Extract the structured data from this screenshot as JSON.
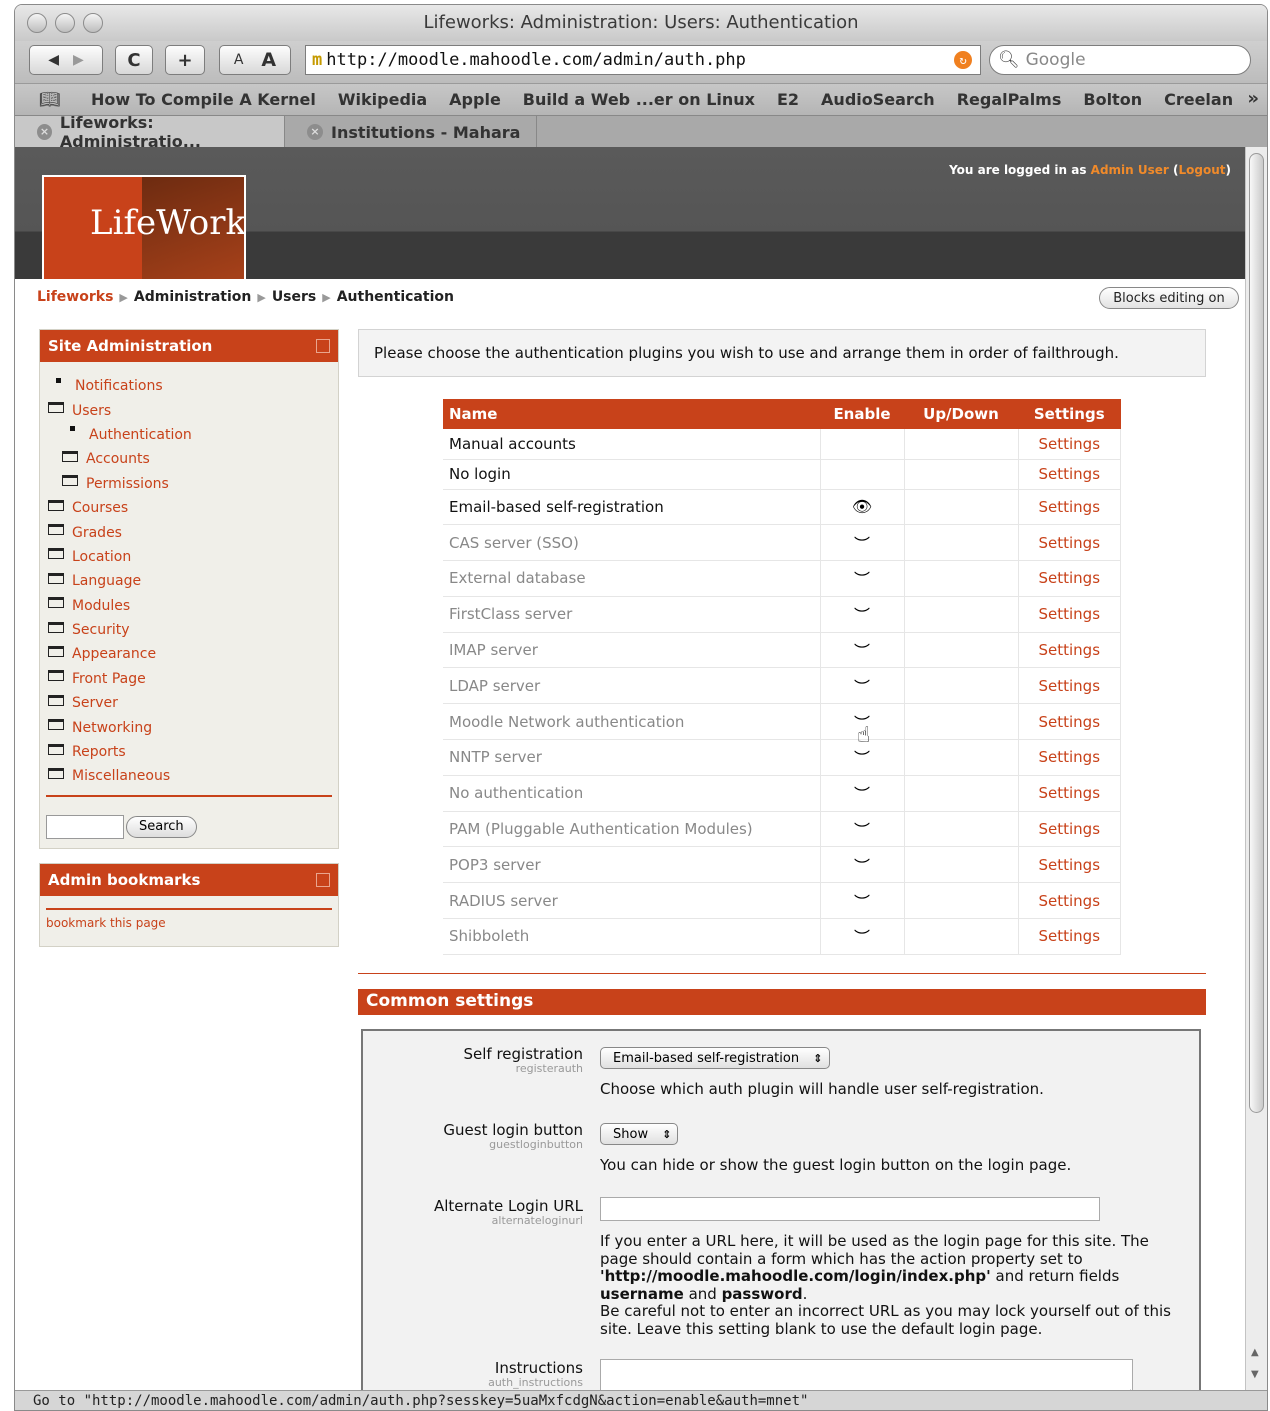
{
  "window": {
    "title": "Lifeworks: Administration: Users: Authentication"
  },
  "toolbar": {
    "back": "◀",
    "forward": "▶",
    "reload": "C",
    "add": "+",
    "text_small": "A",
    "text_large": "A",
    "url": "http://moodle.mahoodle.com/admin/auth.php",
    "search_placeholder": "Google"
  },
  "bookmarks": [
    "How To Compile A Kernel",
    "Wikipedia",
    "Apple",
    "Build a Web ...er on Linux",
    "E2",
    "AudioSearch",
    "RegalPalms",
    "Bolton",
    "Creelan"
  ],
  "tabs": [
    {
      "label": "Lifeworks: Administratio..."
    },
    {
      "label": "Institutions - Mahara"
    }
  ],
  "header": {
    "logo_text": "LifeWorks",
    "logged_prefix": "You are logged in as ",
    "user": "Admin User",
    "logout": "Logout"
  },
  "breadcrumb": [
    "Lifeworks",
    "Administration",
    "Users",
    "Authentication"
  ],
  "blocks_button": "Blocks editing on",
  "sidebar": {
    "title": "Site Administration",
    "items": [
      {
        "label": "Notifications",
        "indent": 0,
        "icon": "bullet"
      },
      {
        "label": "Users",
        "indent": 0,
        "icon": "folder-open"
      },
      {
        "label": "Authentication",
        "indent": 1,
        "icon": "bullet"
      },
      {
        "label": "Accounts",
        "indent": 1,
        "icon": "folder"
      },
      {
        "label": "Permissions",
        "indent": 1,
        "icon": "folder"
      },
      {
        "label": "Courses",
        "indent": 0,
        "icon": "folder"
      },
      {
        "label": "Grades",
        "indent": 0,
        "icon": "folder"
      },
      {
        "label": "Location",
        "indent": 0,
        "icon": "folder"
      },
      {
        "label": "Language",
        "indent": 0,
        "icon": "folder"
      },
      {
        "label": "Modules",
        "indent": 0,
        "icon": "folder"
      },
      {
        "label": "Security",
        "indent": 0,
        "icon": "folder"
      },
      {
        "label": "Appearance",
        "indent": 0,
        "icon": "folder"
      },
      {
        "label": "Front Page",
        "indent": 0,
        "icon": "folder"
      },
      {
        "label": "Server",
        "indent": 0,
        "icon": "folder"
      },
      {
        "label": "Networking",
        "indent": 0,
        "icon": "folder"
      },
      {
        "label": "Reports",
        "indent": 0,
        "icon": "folder"
      },
      {
        "label": "Miscellaneous",
        "indent": 0,
        "icon": "folder"
      }
    ],
    "search_button": "Search"
  },
  "bookmarks_block": {
    "title": "Admin bookmarks",
    "link": "bookmark this page"
  },
  "intro": "Please choose the authentication plugins you wish to use and arrange them in order of failthrough.",
  "auth_table": {
    "headers": [
      "Name",
      "Enable",
      "Up/Down",
      "Settings"
    ],
    "rows": [
      {
        "name": "Manual accounts",
        "enable": "",
        "settings": "Settings",
        "active": true
      },
      {
        "name": "No login",
        "enable": "",
        "settings": "Settings",
        "active": true
      },
      {
        "name": "Email-based self-registration",
        "enable": "open-eye",
        "settings": "Settings",
        "active": true
      },
      {
        "name": "CAS server (SSO)",
        "enable": "closed-eye",
        "settings": "Settings",
        "active": false
      },
      {
        "name": "External database",
        "enable": "closed-eye",
        "settings": "Settings",
        "active": false
      },
      {
        "name": "FirstClass server",
        "enable": "closed-eye",
        "settings": "Settings",
        "active": false
      },
      {
        "name": "IMAP server",
        "enable": "closed-eye",
        "settings": "Settings",
        "active": false
      },
      {
        "name": "LDAP server",
        "enable": "closed-eye",
        "settings": "Settings",
        "active": false
      },
      {
        "name": "Moodle Network authentication",
        "enable": "closed-eye",
        "settings": "Settings",
        "active": false
      },
      {
        "name": "NNTP server",
        "enable": "closed-eye",
        "settings": "Settings",
        "active": false
      },
      {
        "name": "No authentication",
        "enable": "closed-eye",
        "settings": "Settings",
        "active": false
      },
      {
        "name": "PAM (Pluggable Authentication Modules)",
        "enable": "closed-eye",
        "settings": "Settings",
        "active": false
      },
      {
        "name": "POP3 server",
        "enable": "closed-eye",
        "settings": "Settings",
        "active": false
      },
      {
        "name": "RADIUS server",
        "enable": "closed-eye",
        "settings": "Settings",
        "active": false
      },
      {
        "name": "Shibboleth",
        "enable": "closed-eye",
        "settings": "Settings",
        "active": false
      }
    ]
  },
  "common": {
    "title": "Common settings",
    "selfreg": {
      "label": "Self registration",
      "key": "registerauth",
      "value": "Email-based self-registration",
      "desc": "Choose which auth plugin will handle user self-registration."
    },
    "guest": {
      "label": "Guest login button",
      "key": "guestloginbutton",
      "value": "Show",
      "desc": "You can hide or show the guest login button on the login page."
    },
    "alt": {
      "label": "Alternate Login URL",
      "key": "alternateloginurl",
      "value": "",
      "desc1": "If you enter a URL here, it will be used as the login page for this site. The page should contain a form which has the action property set to ",
      "desc_url": "'http://moodle.mahoodle.com/login/index.php'",
      "desc2": " and return fields ",
      "desc_user": "username",
      "desc3": " and ",
      "desc_pass": "password",
      "desc4": ".",
      "desc5": "Be careful not to enter an incorrect URL as you may lock yourself out of this site. Leave this setting blank to use the default login page."
    },
    "instr": {
      "label": "Instructions",
      "key": "auth_instructions"
    }
  },
  "status_bar": "Go to \"http://moodle.mahoodle.com/admin/auth.php?sesskey=5uaMxfcdgN&action=enable&auth=mnet\""
}
